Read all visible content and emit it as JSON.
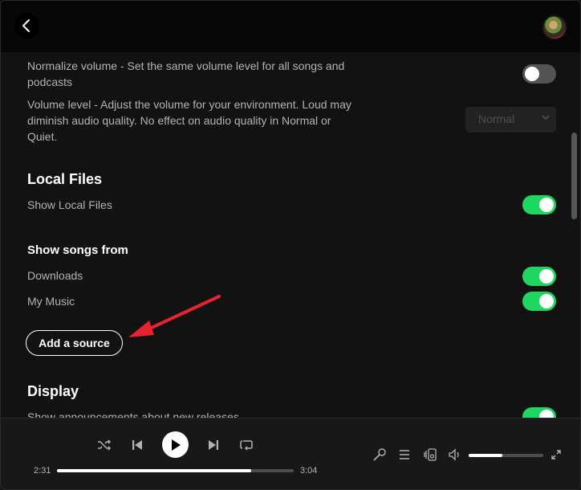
{
  "settings": {
    "normalize_label": "Normalize volume - Set the same volume level for all songs and podcasts",
    "normalize_line1": "Normalize volume - Set the same volume level for all songs and",
    "normalize_line2": "podcasts",
    "volume_level_line1": "Volume level - Adjust the volume for your environment. Loud may",
    "volume_level_line2": "diminish audio quality. No effect on audio quality in Normal or",
    "volume_level_line3": "Quiet.",
    "volume_level_value": "Normal",
    "local_files_heading": "Local Files",
    "show_local_files_label": "Show Local Files",
    "show_songs_from_heading": "Show songs from",
    "downloads_label": "Downloads",
    "my_music_label": "My Music",
    "add_source_label": "Add a source",
    "display_heading": "Display",
    "announcements_label": "Show announcements about new releases",
    "toggles": {
      "normalize_volume": false,
      "show_local_files": true,
      "downloads": true,
      "my_music": true,
      "announcements": true
    }
  },
  "player": {
    "elapsed": "2:31",
    "duration": "3:04",
    "progress_fraction": 0.82,
    "volume_fraction": 0.45
  },
  "colors": {
    "accent_green": "#1ed760",
    "arrow_red": "#e8232f"
  },
  "icons": [
    "back-arrow-icon",
    "shuffle-icon",
    "previous-icon",
    "play-icon",
    "next-icon",
    "repeat-icon",
    "mic-icon",
    "queue-icon",
    "connect-device-icon",
    "volume-icon",
    "fullscreen-icon"
  ]
}
